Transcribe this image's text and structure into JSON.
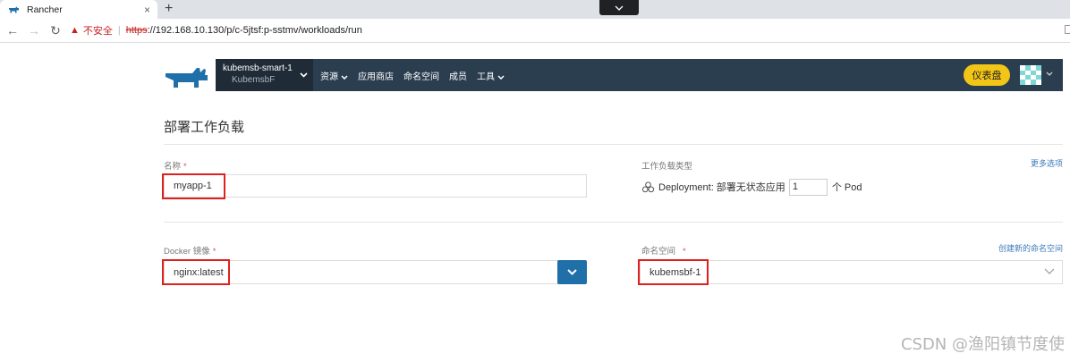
{
  "browser": {
    "tab_title": "Rancher",
    "tab_close": "×",
    "new_tab": "+",
    "insecure_label": "不安全",
    "url_scheme": "https",
    "url_rest": "://192.168.10.130/p/c-5jtsf:p-sstmv/workloads/run",
    "nav_back": "←",
    "nav_forward": "→",
    "nav_reload": "↻"
  },
  "header": {
    "cluster_name": "kubemsb-smart-1",
    "project_name": "KubemsbF",
    "nav": [
      {
        "label": "资源",
        "has_dropdown": true
      },
      {
        "label": "应用商店",
        "has_dropdown": false
      },
      {
        "label": "命名空间",
        "has_dropdown": false
      },
      {
        "label": "成员",
        "has_dropdown": false
      },
      {
        "label": "工具",
        "has_dropdown": true
      }
    ],
    "dashboard_button": "仪表盘",
    "colors": {
      "bar": "#2b3e50",
      "cluster_bg": "#1f2c38",
      "dashboard": "#f3c517",
      "logo": "#1f6fa8"
    }
  },
  "page": {
    "title": "部署工作负载",
    "more_options": "更多选项",
    "create_namespace": "创建新的命名空间"
  },
  "form": {
    "name_label": "名称",
    "name_value": "myapp-1",
    "workload_type_label": "工作负载类型",
    "workload_type_value": "Deployment: 部署无状态应用",
    "scale_value": "1",
    "scale_unit": "个 Pod",
    "image_label": "Docker 镜像",
    "image_value": "nginx:latest",
    "namespace_label": "命名空间",
    "namespace_value": "kubemsbf-1",
    "required_mark": "*"
  },
  "watermark": "CSDN @渔阳镇节度使"
}
